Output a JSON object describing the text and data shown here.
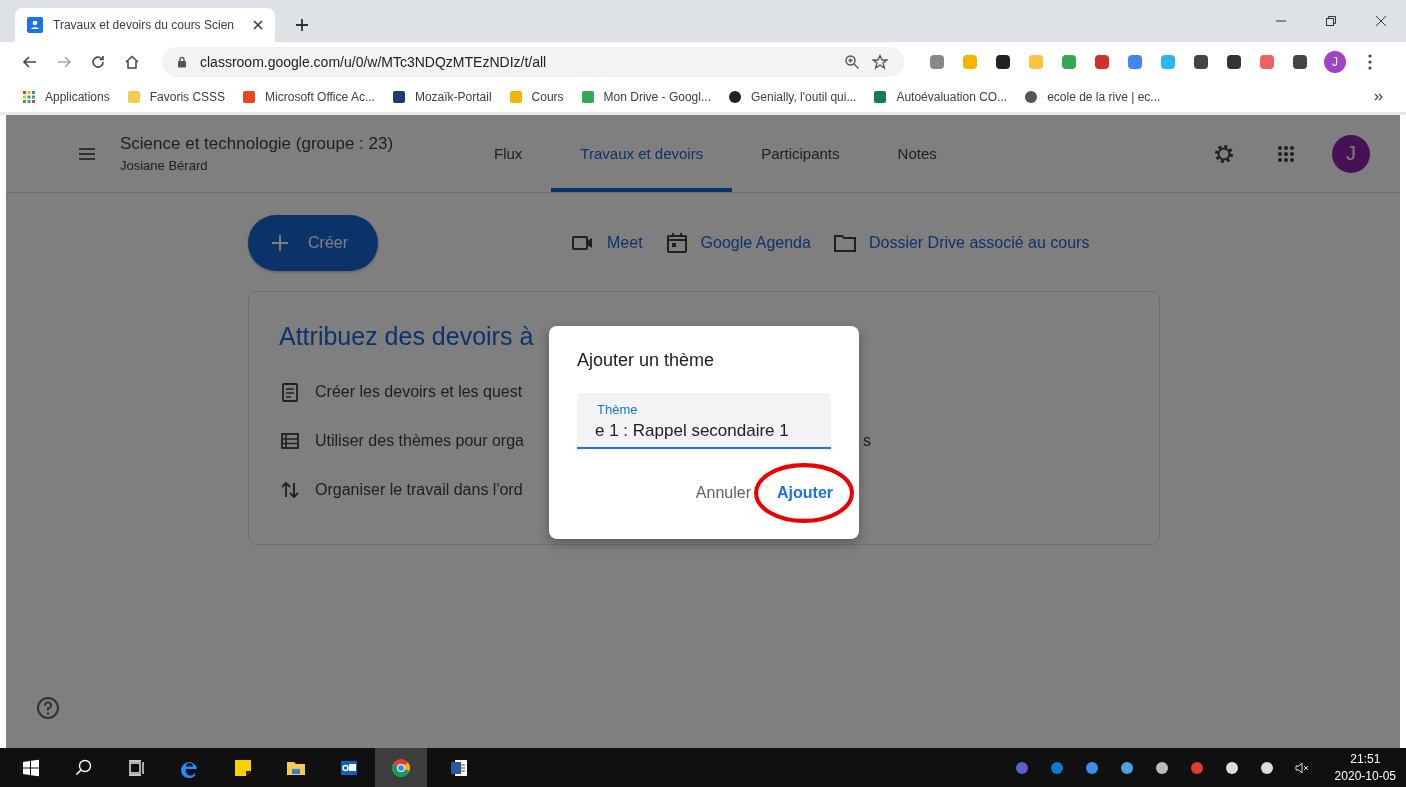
{
  "browser": {
    "tab": {
      "title": "Travaux et devoirs du cours Scien"
    },
    "url": "classroom.google.com/u/0/w/MTc3NDQzMTEzNDIz/t/all",
    "profile_initial": "J",
    "bookmarks": [
      {
        "label": "Applications"
      },
      {
        "label": "Favoris CSSS"
      },
      {
        "label": "Microsoft Office Ac..."
      },
      {
        "label": "Mozaïk-Portail"
      },
      {
        "label": "Cours"
      },
      {
        "label": "Mon Drive - Googl..."
      },
      {
        "label": "Genially, l'outil qui..."
      },
      {
        "label": "Autoévaluation CO..."
      },
      {
        "label": "ecole de la rive | ec..."
      }
    ]
  },
  "classroom": {
    "course_title": "Science et technologie (groupe : 23)",
    "teacher": "Josiane Bérard",
    "avatar_initial": "J",
    "tabs": [
      {
        "label": "Flux",
        "selected": false
      },
      {
        "label": "Travaux et devoirs",
        "selected": true
      },
      {
        "label": "Participants",
        "selected": false
      },
      {
        "label": "Notes",
        "selected": false
      }
    ],
    "create_button": "Créer",
    "links": [
      {
        "label": "Meet"
      },
      {
        "label": "Google Agenda"
      },
      {
        "label": "Dossier Drive associé au cours"
      }
    ],
    "card": {
      "heading": "Attribuez des devoirs à",
      "rows": [
        {
          "text": "Créer les devoirs et les quest"
        },
        {
          "text": "Utiliser des thèmes pour orga",
          "tail": "s"
        },
        {
          "text": "Organiser le travail dans l'ord"
        }
      ]
    }
  },
  "dialog": {
    "title": "Ajouter un thème",
    "field": {
      "label": "Thème",
      "value": "e 1 : Rappel secondaire 1"
    },
    "buttons": [
      {
        "label": "Annuler",
        "primary": false,
        "circled": false
      },
      {
        "label": "Ajouter",
        "primary": true,
        "circled": true
      }
    ]
  },
  "taskbar": {
    "time": "21:51",
    "date": "2020-10-05"
  }
}
